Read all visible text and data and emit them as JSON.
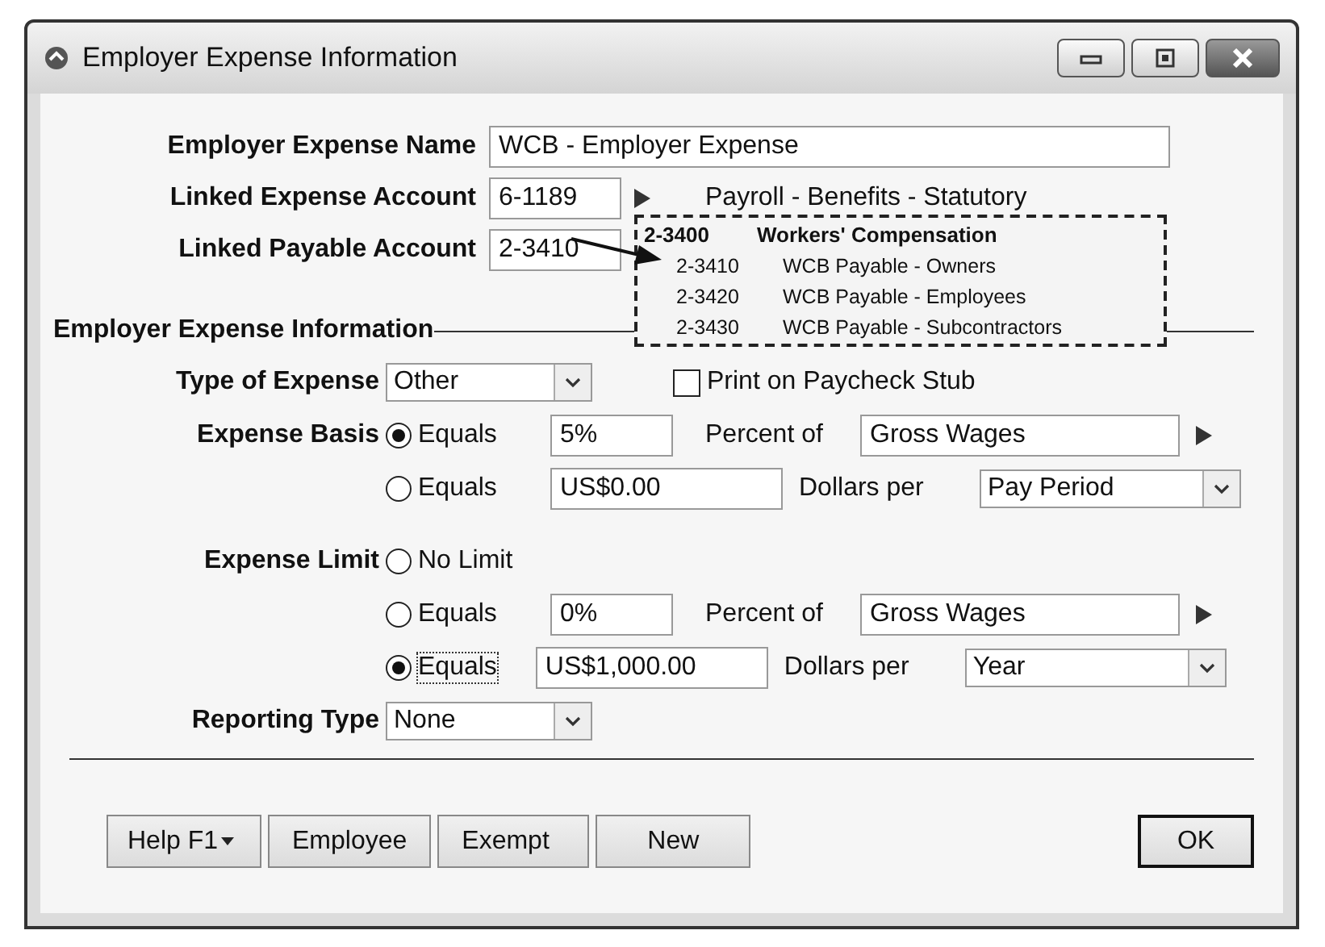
{
  "window": {
    "title": "Employer Expense Information"
  },
  "fields": [
    {
      "label": "Employer Expense Name",
      "value": "WCB - Employer Expense"
    },
    {
      "label": "Linked Expense Account",
      "value": "6-1189",
      "account_name": "Payroll - Benefits - Statutory"
    },
    {
      "label": "Linked Payable Account",
      "value": "2-3410"
    }
  ],
  "account_popup": {
    "header_code": "2-3400",
    "header_name": "Workers' Compensation",
    "rows": [
      {
        "code": "2-3410",
        "name": "WCB Payable - Owners"
      },
      {
        "code": "2-3420",
        "name": "WCB Payable - Employees"
      },
      {
        "code": "2-3430",
        "name": "WCB Payable - Subcontractors"
      }
    ]
  },
  "section": {
    "title": "Employer Expense Information"
  },
  "type_of_expense": {
    "label": "Type of Expense",
    "value": "Other"
  },
  "print_on_stub": {
    "label": "Print on Paycheck Stub",
    "checked": false
  },
  "expense_basis": {
    "label": "Expense Basis",
    "options": [
      {
        "label": "Equals",
        "selected": true,
        "value": "5%",
        "unit": "Percent of",
        "select": "Gross Wages",
        "kind": "link"
      },
      {
        "label": "Equals",
        "selected": false,
        "value": "US$0.00",
        "unit": "Dollars per",
        "select": "Pay Period",
        "kind": "dropdown"
      }
    ]
  },
  "expense_limit": {
    "label": "Expense Limit",
    "options": [
      {
        "label": "No Limit",
        "selected": false,
        "kind": "plain"
      },
      {
        "label": "Equals",
        "selected": false,
        "value": "0%",
        "unit": "Percent of",
        "select": "Gross Wages",
        "kind": "link"
      },
      {
        "label": "Equals",
        "selected": true,
        "value": "US$1,000.00",
        "unit": "Dollars per",
        "select": "Year",
        "kind": "dropdown"
      }
    ]
  },
  "reporting_type": {
    "label": "Reporting Type",
    "value": "None"
  },
  "buttons": [
    {
      "label": "Help F1",
      "kind": "menu"
    },
    {
      "label": "Employee",
      "kind": "plain"
    },
    {
      "label": "Exempt",
      "kind": "plain"
    },
    {
      "label": "New",
      "kind": "plain"
    }
  ],
  "ok_button": {
    "label": "OK"
  }
}
